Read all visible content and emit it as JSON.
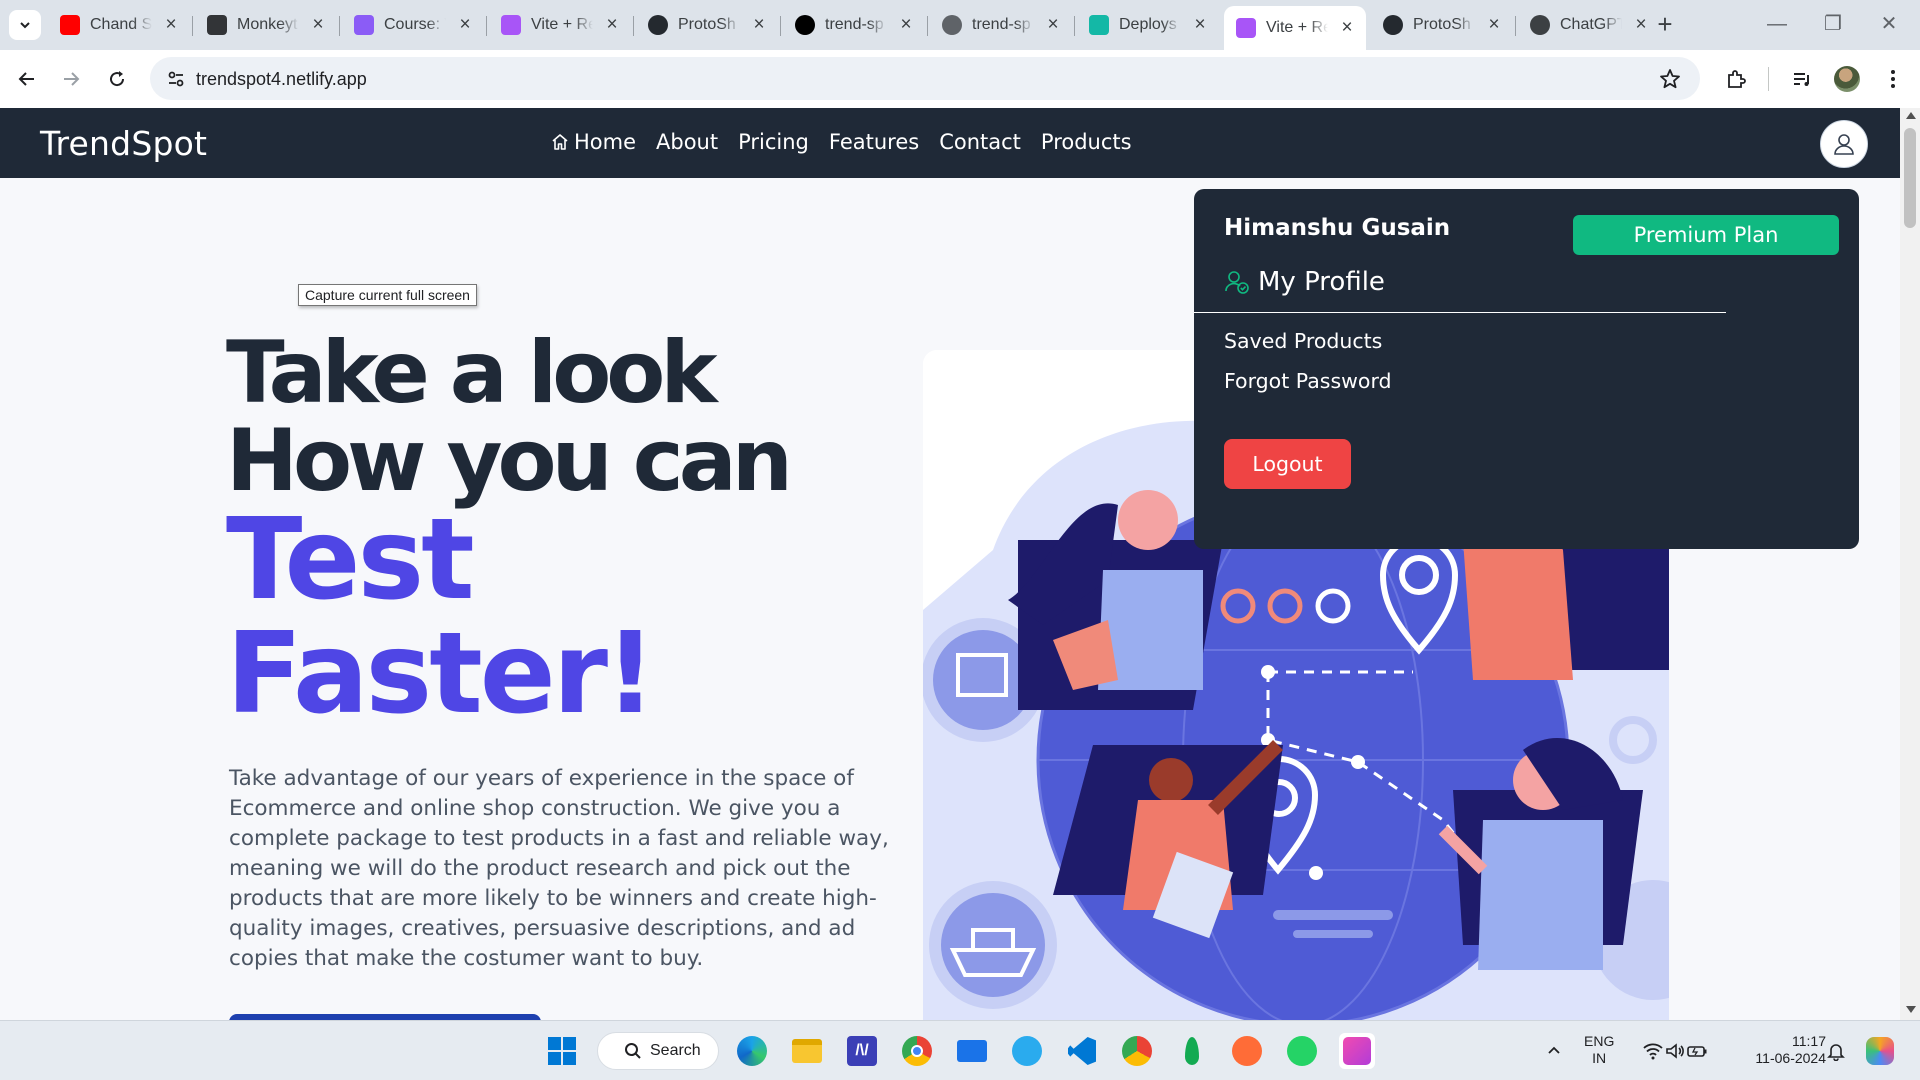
{
  "browser": {
    "tabs": [
      {
        "title": "Chand Si",
        "favicon": "youtube-icon",
        "color": "#ff0000"
      },
      {
        "title": "Monkeyt",
        "favicon": "monkeytype-icon",
        "color": "#323437"
      },
      {
        "title": "Course: V",
        "favicon": "course-icon",
        "color": "#8b5cf6"
      },
      {
        "title": "Vite + Re",
        "favicon": "vite-icon",
        "color": "#a855f7"
      },
      {
        "title": "ProtoSh",
        "favicon": "github-icon",
        "color": "#24292f"
      },
      {
        "title": "trend-sp",
        "favicon": "vercel-icon",
        "color": "#000000"
      },
      {
        "title": "trend-sp",
        "favicon": "globe-icon",
        "color": "#5f6368"
      },
      {
        "title": "Deploys",
        "favicon": "netlify-icon",
        "color": "#14b8a6"
      },
      {
        "title": "Vite + Re",
        "favicon": "vite-icon",
        "color": "#a855f7",
        "active": true
      },
      {
        "title": "ProtoSh",
        "favicon": "github-icon",
        "color": "#24292f"
      },
      {
        "title": "ChatGPT",
        "favicon": "chatgpt-icon",
        "color": "#3c4043"
      }
    ],
    "url": "trendspot4.netlify.app"
  },
  "site": {
    "brand": "TrendSpot",
    "nav": [
      "Home",
      "About",
      "Pricing",
      "Features",
      "Contact",
      "Products"
    ],
    "tooltip": "Capture current full screen",
    "hero": {
      "line1": "Take a look",
      "line2": "How you can",
      "line3": "Test",
      "line4": "Faster!",
      "description": "Take advantage of our years of experience in the space of Ecommerce and online shop construction. We give you a complete package to test products in a fast and reliable way, meaning we will do the product research and pick out the products that are more likely to be winners and create high-quality images, creatives, persuasive descriptions, and ad copies that make the costumer want to buy."
    },
    "profile_menu": {
      "user_name": "Himanshu Gusain",
      "plan_button": "Premium Plan",
      "my_profile": "My Profile",
      "saved_products": "Saved Products",
      "forgot_password": "Forgot Password",
      "logout": "Logout"
    }
  },
  "taskbar": {
    "search_label": "Search",
    "language": "ENG",
    "region": "IN",
    "time": "11:17",
    "date": "11-06-2024"
  },
  "colors": {
    "navbar_bg": "#1f2937",
    "accent_purple": "#4f46e5",
    "premium_green": "#10b981",
    "logout_red": "#ef4444"
  }
}
